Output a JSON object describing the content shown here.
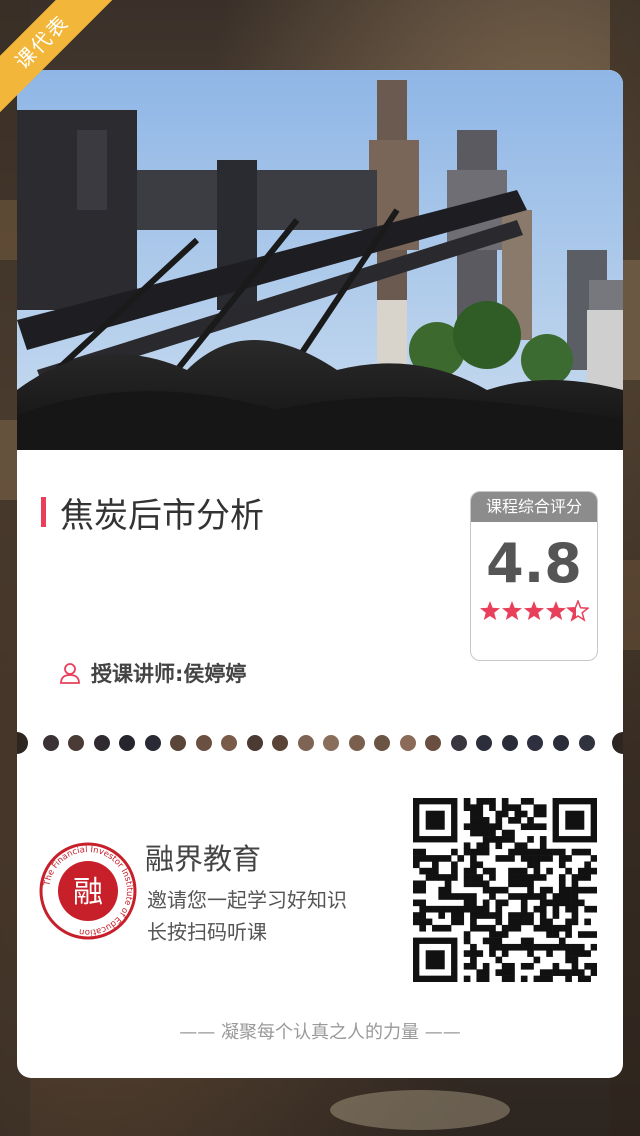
{
  "ribbon": {
    "label": "课代表",
    "color": "#f2b73a"
  },
  "course": {
    "title": "焦炭后市分析",
    "accent_color": "#e8405a",
    "teacher_label": "授课讲师:侯婷婷",
    "teacher_icon": "user-icon"
  },
  "rating": {
    "label": "课程综合评分",
    "score": "4.8",
    "stars_value": 4.8,
    "stars_max": 5,
    "star_color": "#e8405a"
  },
  "brand": {
    "name": "融界教育",
    "invite_line1": "邀请您一起学习好知识",
    "invite_line2": "长按扫码听课",
    "logo_char": "融",
    "logo_ring_text": "The Financial Investor Institute of Education",
    "logo_color": "#c8202a"
  },
  "footer": {
    "slogan": "—— 凝聚每个认真之人的力量 ——"
  },
  "qr_icon": "qr-code-icon"
}
